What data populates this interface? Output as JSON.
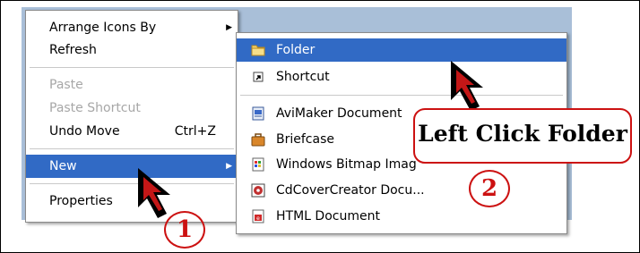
{
  "context_menu": {
    "items": [
      {
        "label": "Arrange Icons By",
        "shortcut": "",
        "has_submenu": true,
        "disabled": false
      },
      {
        "label": "Refresh",
        "shortcut": "",
        "has_submenu": false,
        "disabled": false
      },
      {
        "label": "Paste",
        "shortcut": "",
        "has_submenu": false,
        "disabled": true
      },
      {
        "label": "Paste Shortcut",
        "shortcut": "",
        "has_submenu": false,
        "disabled": true
      },
      {
        "label": "Undo Move",
        "shortcut": "Ctrl+Z",
        "has_submenu": false,
        "disabled": false
      },
      {
        "label": "New",
        "shortcut": "",
        "has_submenu": true,
        "disabled": false,
        "highlighted": true
      },
      {
        "label": "Properties",
        "shortcut": "",
        "has_submenu": false,
        "disabled": false
      }
    ],
    "submenu_arrow": "▶"
  },
  "new_submenu": {
    "items": [
      {
        "label": "Folder",
        "icon": "folder-icon",
        "highlighted": true
      },
      {
        "label": "Shortcut",
        "icon": "shortcut-icon"
      },
      {
        "label": "AviMaker Document",
        "icon": "avimaker-document-icon"
      },
      {
        "label": "Briefcase",
        "icon": "briefcase-icon"
      },
      {
        "label": "Windows Bitmap Imag",
        "icon": "bitmap-image-icon"
      },
      {
        "label": "CdCoverCreator Docu...",
        "icon": "cdcovercreator-document-icon"
      },
      {
        "label": "HTML Document",
        "icon": "html-document-icon"
      }
    ]
  },
  "annotations": {
    "callout": "Left Click Folder",
    "step1": "1",
    "step2": "2"
  },
  "colors": {
    "highlight": "#316ac5",
    "annotation_red": "#cc1111",
    "desktop": "#a9bfd8",
    "disabled_text": "#a7a7a7"
  }
}
